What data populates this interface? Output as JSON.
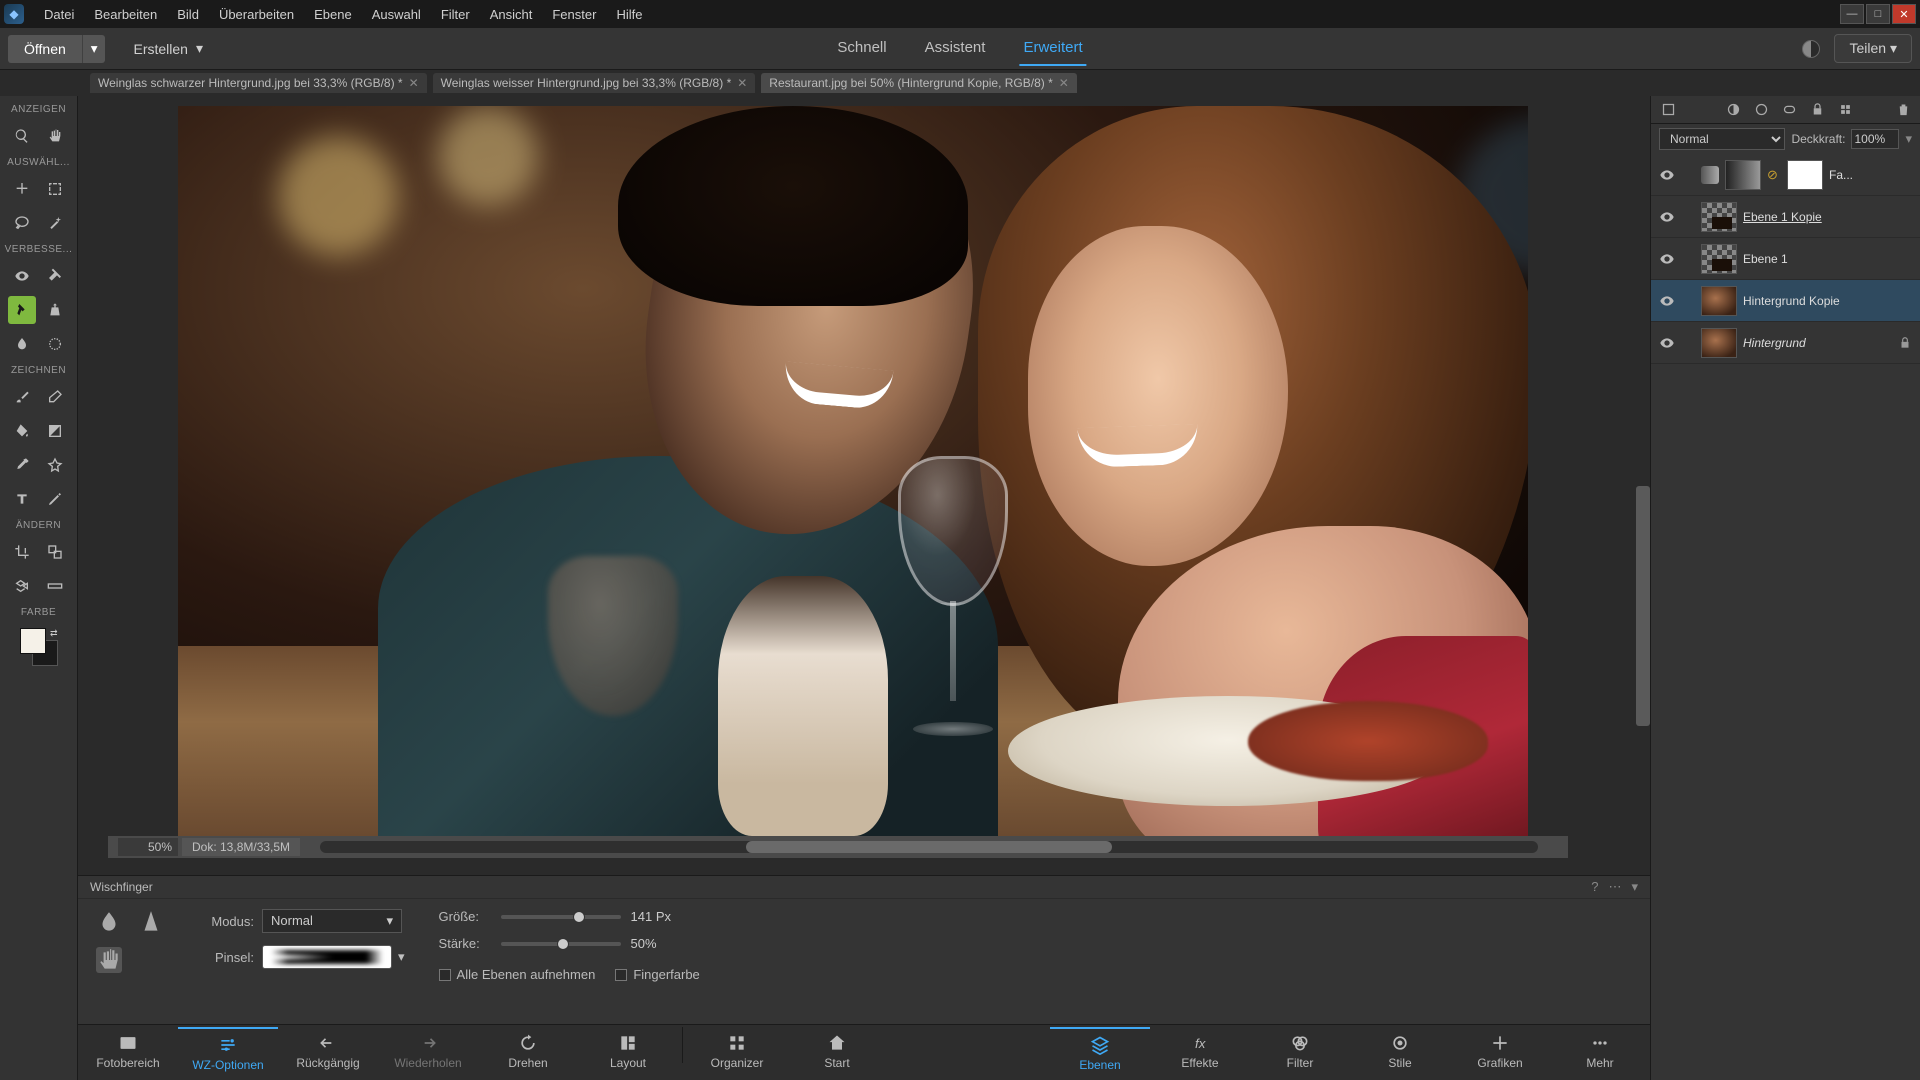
{
  "menubar": [
    "Datei",
    "Bearbeiten",
    "Bild",
    "Überarbeiten",
    "Ebene",
    "Auswahl",
    "Filter",
    "Ansicht",
    "Fenster",
    "Hilfe"
  ],
  "toolbar": {
    "open": "Öffnen",
    "create": "Erstellen",
    "share": "Teilen"
  },
  "modes": {
    "schnell": "Schnell",
    "assistent": "Assistent",
    "erweitert": "Erweitert",
    "active": "erweitert"
  },
  "doc_tabs": [
    {
      "label": "Weinglas schwarzer Hintergrund.jpg bei 33,3% (RGB/8) *",
      "active": false
    },
    {
      "label": "Weinglas weisser Hintergrund.jpg bei 33,3% (RGB/8) *",
      "active": false
    },
    {
      "label": "Restaurant.jpg bei 50% (Hintergrund Kopie, RGB/8) *",
      "active": true
    }
  ],
  "tool_sections": {
    "anzeigen": "ANZEIGEN",
    "auswahl": "AUSWÄHL...",
    "verbessern": "VERBESSE...",
    "zeichnen": "ZEICHNEN",
    "aendern": "ÄNDERN",
    "farbe": "FARBE"
  },
  "status": {
    "zoom": "50%",
    "doc": "Dok: 13,8M/33,5M"
  },
  "layers_panel": {
    "blend_mode": "Normal",
    "opacity_label": "Deckkraft:",
    "opacity_val": "100%",
    "layers": [
      {
        "name": "Fa...",
        "type": "adjust",
        "underline": false,
        "italic": false
      },
      {
        "name": "Ebene 1 Kopie",
        "type": "pixel",
        "underline": true,
        "italic": false
      },
      {
        "name": "Ebene 1",
        "type": "pixel",
        "underline": false,
        "italic": false
      },
      {
        "name": "Hintergrund Kopie",
        "type": "image",
        "underline": false,
        "italic": false,
        "selected": true
      },
      {
        "name": "Hintergrund",
        "type": "image",
        "underline": false,
        "italic": true,
        "locked": true
      }
    ]
  },
  "options": {
    "tool_name": "Wischfinger",
    "mode_label": "Modus:",
    "mode_val": "Normal",
    "brush_label": "Pinsel:",
    "size_label": "Größe:",
    "size_val": "141 Px",
    "strength_label": "Stärke:",
    "strength_val": "50%",
    "chk_all": "Alle Ebenen aufnehmen",
    "chk_finger": "Fingerfarbe"
  },
  "bottom_bar": {
    "left": [
      "Fotobereich",
      "WZ-Optionen",
      "Rückgängig",
      "Wiederholen",
      "Drehen",
      "Layout",
      "Organizer",
      "Start"
    ],
    "left_active": "WZ-Optionen",
    "right": [
      "Ebenen",
      "Effekte",
      "Filter",
      "Stile",
      "Grafiken",
      "Mehr"
    ],
    "right_active": "Ebenen"
  }
}
